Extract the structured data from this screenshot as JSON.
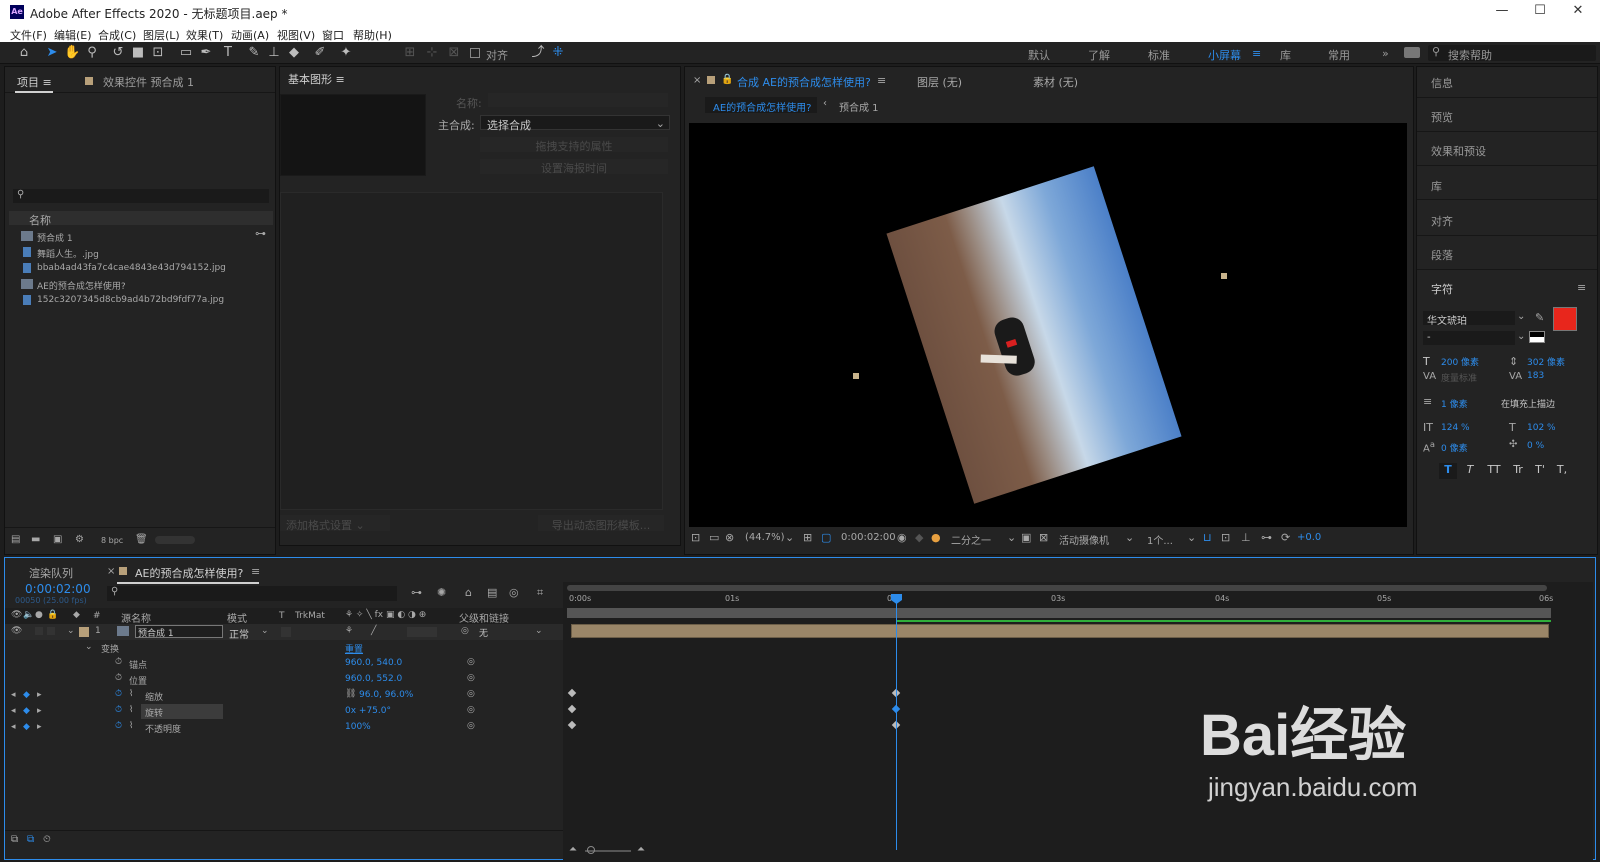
{
  "app": {
    "title": "Adobe After Effects 2020 - 无标题项目.aep *",
    "logo": "Ae"
  },
  "menu": [
    "文件(F)",
    "编辑(E)",
    "合成(C)",
    "图层(L)",
    "效果(T)",
    "动画(A)",
    "视图(V)",
    "窗口",
    "帮助(H)"
  ],
  "toolbar": {
    "snap_label": "对齐",
    "workspaces": [
      "默认",
      "了解",
      "标准",
      "小屏幕",
      "库",
      "常用"
    ],
    "active_workspace": "小屏幕",
    "search_placeholder": "搜索帮助"
  },
  "project_panel": {
    "tab_label": "项目",
    "effect_tab_label": "效果控件 预合成 1",
    "column_name": "名称",
    "items": [
      "预合成 1",
      "舞蹈人生。.jpg",
      "bbab4ad43fa7c4cae4843e43d794152.jpg",
      "AE的预合成怎样使用?",
      "152c3207345d8cb9ad4b72bd9fdf77a.jpg"
    ],
    "bpc": "8 bpc"
  },
  "essential_graphics": {
    "tab_label": "基本图形",
    "name_label": "名称:",
    "master_label": "主合成:",
    "master_value": "选择合成",
    "btn_props": "拖拽支持的属性",
    "btn_poster": "设置海报时间",
    "btn_add": "添加格式设置",
    "btn_export": "导出动态图形模板..."
  },
  "composition": {
    "tab_label": "合成 AE的预合成怎样使用?",
    "layer_label": "图层 (无)",
    "footage_label": "素材 (无)",
    "breadcrumb_active": "AE的预合成怎样使用?",
    "breadcrumb_next": "预合成 1",
    "zoom": "(44.7%)",
    "timecode": "0:00:02:00",
    "resolution": "二分之一",
    "camera": "活动摄像机",
    "views": "1个...",
    "exposure": "+0.0"
  },
  "right_panels": [
    "信息",
    "预览",
    "效果和预设",
    "库",
    "对齐",
    "段落"
  ],
  "character": {
    "title": "字符",
    "font": "华文琥珀",
    "style": "-",
    "size": "200 像素",
    "leading": "302 像素",
    "kerning": "度量标准",
    "tracking": "183",
    "stroke": "1 像素",
    "stroke_mode": "在填充上描边",
    "vscale": "124 %",
    "hscale": "102 %",
    "baseline": "0 像素",
    "tsume": "0 %",
    "fill_color": "#e8261c",
    "stroke_color": "#f0c03a",
    "styles": [
      "T",
      "T",
      "TT",
      "Tr",
      "T'",
      "T,"
    ]
  },
  "timeline": {
    "render_tab": "渲染队列",
    "comp_tab": "AE的预合成怎样使用?",
    "timecode": "0:00:02:00",
    "frames": "00050 (25.00 fps)",
    "headers": {
      "source": "源名称",
      "mode": "模式",
      "t": "T",
      "trkmat": "TrkMat",
      "parent": "父级和链接"
    },
    "layer": {
      "num": "1",
      "name": "预合成 1",
      "mode": "正常",
      "parent": "无"
    },
    "transform": {
      "label": "变换",
      "reset": "重置"
    },
    "props": [
      {
        "name": "锚点",
        "value": "960.0, 540.0"
      },
      {
        "name": "位置",
        "value": "960.0, 552.0"
      },
      {
        "name": "缩放",
        "value": "96.0, 96.0%"
      },
      {
        "name": "旋转",
        "value": "0x +75.0°"
      },
      {
        "name": "不透明度",
        "value": "100%"
      }
    ],
    "ruler": [
      "0:00s",
      "01s",
      "02s",
      "03s",
      "04s",
      "05s",
      "06s"
    ]
  },
  "watermark": {
    "brand": "Bai经验",
    "url": "jingyan.baidu.com"
  }
}
